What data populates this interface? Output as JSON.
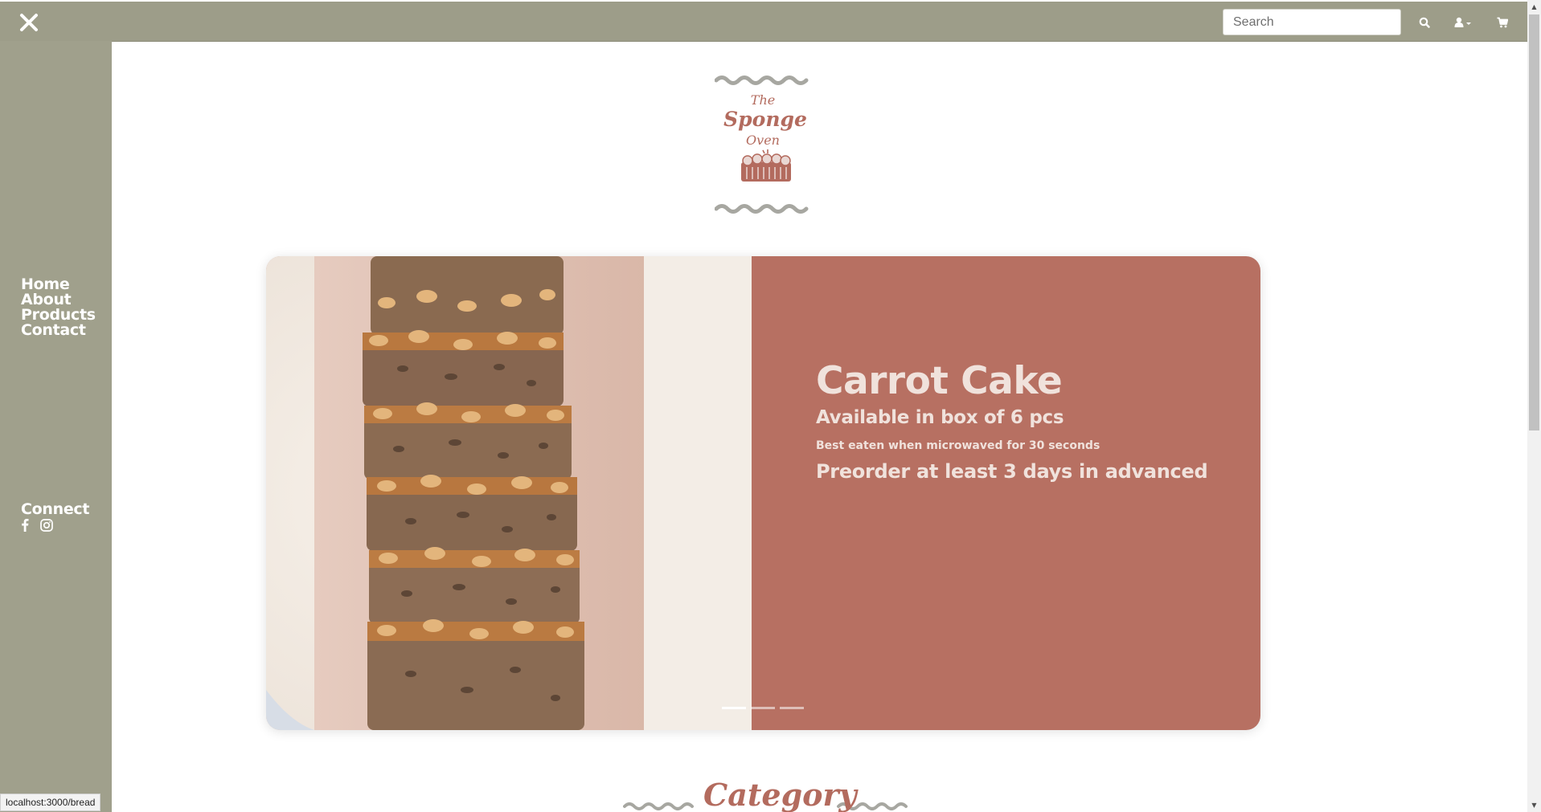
{
  "colors": {
    "navbar": "#9d9d89",
    "sidebar": "#a0a08c",
    "hero_panel": "#b77062",
    "hero_text": "#f0e2dc",
    "brand": "#b36b5e"
  },
  "topbar": {
    "close_icon": "close-icon",
    "search_placeholder": "Search",
    "search_icon": "search-icon",
    "account_icon": "user-dropdown-icon",
    "cart_icon": "cart-icon"
  },
  "sidebar": {
    "nav": [
      "Home",
      "About",
      "Products",
      "Contact"
    ],
    "connect_title": "Connect",
    "social_icons": [
      "facebook-icon",
      "instagram-icon"
    ]
  },
  "logo": {
    "line1": "The",
    "line2": "Sponge",
    "line3": "Oven"
  },
  "hero": {
    "title": "Carrot Cake",
    "subtitle": "Available in box of 6 pcs",
    "note": "Best eaten when microwaved for 30 seconds",
    "preorder": "Preorder at least 3 days in advanced",
    "slides": 3,
    "active_slide": 1
  },
  "category": {
    "title": "Category"
  },
  "status": {
    "url": "localhost:3000/bread"
  }
}
